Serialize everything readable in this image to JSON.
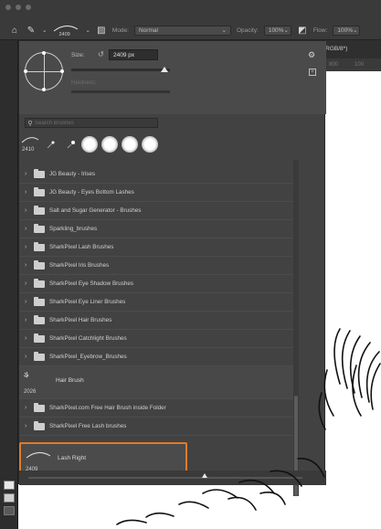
{
  "toolbar": {
    "brush_size": "2409",
    "mode_label": "Mode:",
    "mode_value": "Normal",
    "opacity_label": "Opacity:",
    "opacity_value": "100%",
    "flow_label": "Flow:",
    "flow_value": "100%"
  },
  "document": {
    "tab_title": "(RGB/8*)",
    "ruler_marks": [
      "800",
      "100"
    ]
  },
  "brush_panel": {
    "size_label": "Size:",
    "size_value": "2409 px",
    "hardness_label": "Hardness:",
    "search_placeholder": "Search Brushes",
    "recent_brush_size": "2410",
    "folders": [
      "JG Beauty - Irises",
      "JG Beauty - Eyes Bottom Lashes",
      "Salt and Sugar Generator - Brushes",
      "Sparkling_brushes",
      "SharkPixel Lash Brushes",
      "SharkPixel Iris Brushes",
      "SharkPixel Eye Shadow Brushes",
      "SharkPixel Eye Liner Brushes",
      "SharkPixel Hair Brushes",
      "SharkPixel Catchlight Brushes",
      "SharkPixel_Eyebrow_Brushes"
    ],
    "hair_brush": {
      "name": "Hair Brush",
      "size": "2026"
    },
    "folders_after": [
      "SharkPixel.com Free Hair Brush inside Folder",
      "SharkPixel Free Lash brushes"
    ],
    "selected_brush": {
      "name": "Lash Right",
      "size": "2409"
    }
  },
  "colors": {
    "panel_bg": "#424242",
    "toolbar_bg": "#3a3a3a",
    "selection_accent": "#e07a2a"
  }
}
